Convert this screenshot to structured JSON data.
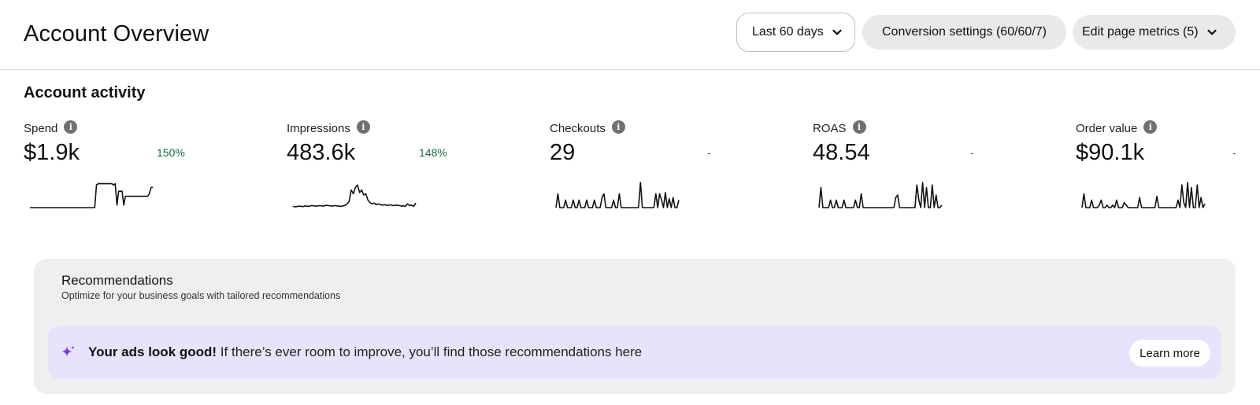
{
  "header": {
    "title": "Account Overview",
    "date_range_label": "Last 60 days",
    "conversion_settings_label": "Conversion settings (60/60/7)",
    "edit_metrics_label": "Edit page metrics (5)"
  },
  "activity": {
    "title": "Account activity",
    "metrics": [
      {
        "label": "Spend",
        "value": "$1.9k",
        "delta": "150%",
        "sparkline": [
          0,
          0,
          0,
          0,
          0,
          0,
          0,
          0,
          0,
          0,
          0,
          0,
          0,
          0,
          0,
          0,
          0,
          0,
          0,
          0,
          0,
          0,
          0,
          0,
          0,
          0,
          0,
          0,
          0,
          0,
          0,
          0,
          0,
          0,
          0,
          0,
          0,
          0,
          0,
          0.9,
          0.95,
          0.95,
          0.95,
          0.95,
          0.95,
          0.95,
          0.95,
          0.95,
          0.95,
          0.9,
          0.95,
          0.1,
          0.65,
          0.65,
          0.65,
          0.1,
          0.45,
          0.45,
          0.45,
          0.45,
          0.45,
          0.45,
          0.45,
          0.45,
          0.45,
          0.45,
          0.45,
          0.45,
          0.45,
          0.45,
          0.55,
          0.8,
          0.8
        ]
      },
      {
        "label": "Impressions",
        "value": "483.6k",
        "delta": "148%",
        "sparkline": [
          0.05,
          0.03,
          0.04,
          0.06,
          0.05,
          0.04,
          0.07,
          0.05,
          0.06,
          0.08,
          0.07,
          0.06,
          0.07,
          0.08,
          0.06,
          0.07,
          0.09,
          0.08,
          0.07,
          0.06,
          0.08,
          0.07,
          0.06,
          0.05,
          0.07,
          0.09,
          0.15,
          0.25,
          0.7,
          0.55,
          0.8,
          0.9,
          0.6,
          0.7,
          0.5,
          0.55,
          0.3,
          0.2,
          0.15,
          0.18,
          0.12,
          0.15,
          0.12,
          0.1,
          0.12,
          0.09,
          0.1,
          0.11,
          0.08,
          0.09,
          0.1,
          0.08,
          0.06,
          0.07,
          0.05,
          0.15,
          0.08,
          0.1,
          0.05,
          0.18
        ]
      },
      {
        "label": "Checkouts",
        "value": "29",
        "delta": "-",
        "sparkline": [
          0,
          0.55,
          0,
          0,
          0,
          0.3,
          0,
          0,
          0,
          0.3,
          0,
          0,
          0.3,
          0,
          0,
          0,
          0.3,
          0,
          0,
          0,
          0.3,
          0,
          0,
          0,
          0.4,
          0.55,
          0,
          0,
          0,
          0,
          0.3,
          0,
          0,
          0.55,
          0,
          0,
          0,
          0,
          0,
          0,
          0,
          0,
          0,
          0,
          1,
          0,
          0,
          0,
          0,
          0,
          0,
          0,
          0.55,
          0,
          0.55,
          0.3,
          0,
          0.6,
          0,
          0.35,
          0,
          0.4,
          0,
          0,
          0.3
        ]
      },
      {
        "label": "ROAS",
        "value": "48.54",
        "delta": "-",
        "sparkline": [
          0,
          0.8,
          0,
          0,
          0,
          0,
          0.3,
          0,
          0,
          0.3,
          0,
          0,
          0,
          0.3,
          0,
          0,
          0,
          0,
          0,
          0.3,
          0,
          0,
          0.55,
          0,
          0,
          0,
          0,
          0,
          0,
          0,
          0,
          0,
          0,
          0,
          0,
          0,
          0,
          0,
          0,
          0,
          0.4,
          0.5,
          0,
          0,
          0,
          0,
          0,
          0,
          0,
          0,
          0,
          0.9,
          0.3,
          0,
          1,
          0,
          0.8,
          0,
          0,
          0.9,
          0,
          0.5,
          0,
          0,
          0.1
        ]
      },
      {
        "label": "Order value",
        "value": "$90.1k",
        "delta": "-",
        "sparkline": [
          0,
          0.55,
          0,
          0,
          0,
          0.3,
          0,
          0,
          0,
          0.1,
          0.3,
          0,
          0,
          0.1,
          0,
          0,
          0.1,
          0,
          0.3,
          0,
          0,
          0,
          0.2,
          0.1,
          0,
          0,
          0,
          0,
          0,
          0,
          0.4,
          0,
          0,
          0,
          0,
          0,
          0,
          0,
          0,
          0.45,
          0,
          0,
          0,
          0,
          0,
          0,
          0,
          0,
          0,
          0,
          0.3,
          0,
          0.9,
          0.2,
          0,
          1,
          0,
          0.8,
          0,
          0,
          0.9,
          0,
          0.4,
          0,
          0.15
        ]
      }
    ]
  },
  "recommendations": {
    "title": "Recommendations",
    "subtitle": "Optimize for your business goals with tailored recommendations",
    "banner_bold": "Your ads look good!",
    "banner_text": " If there’s ever room to improve, you’ll find those recommendations here",
    "learn_more_label": "Learn more"
  },
  "colors": {
    "positive_delta": "#1a6b3f",
    "banner_bg": "#e8e3fb",
    "sparkle": "#7b3fe4"
  },
  "icons": {
    "chevron": "chevron-down-icon",
    "info": "info-icon",
    "sparkle": "sparkle-icon"
  }
}
